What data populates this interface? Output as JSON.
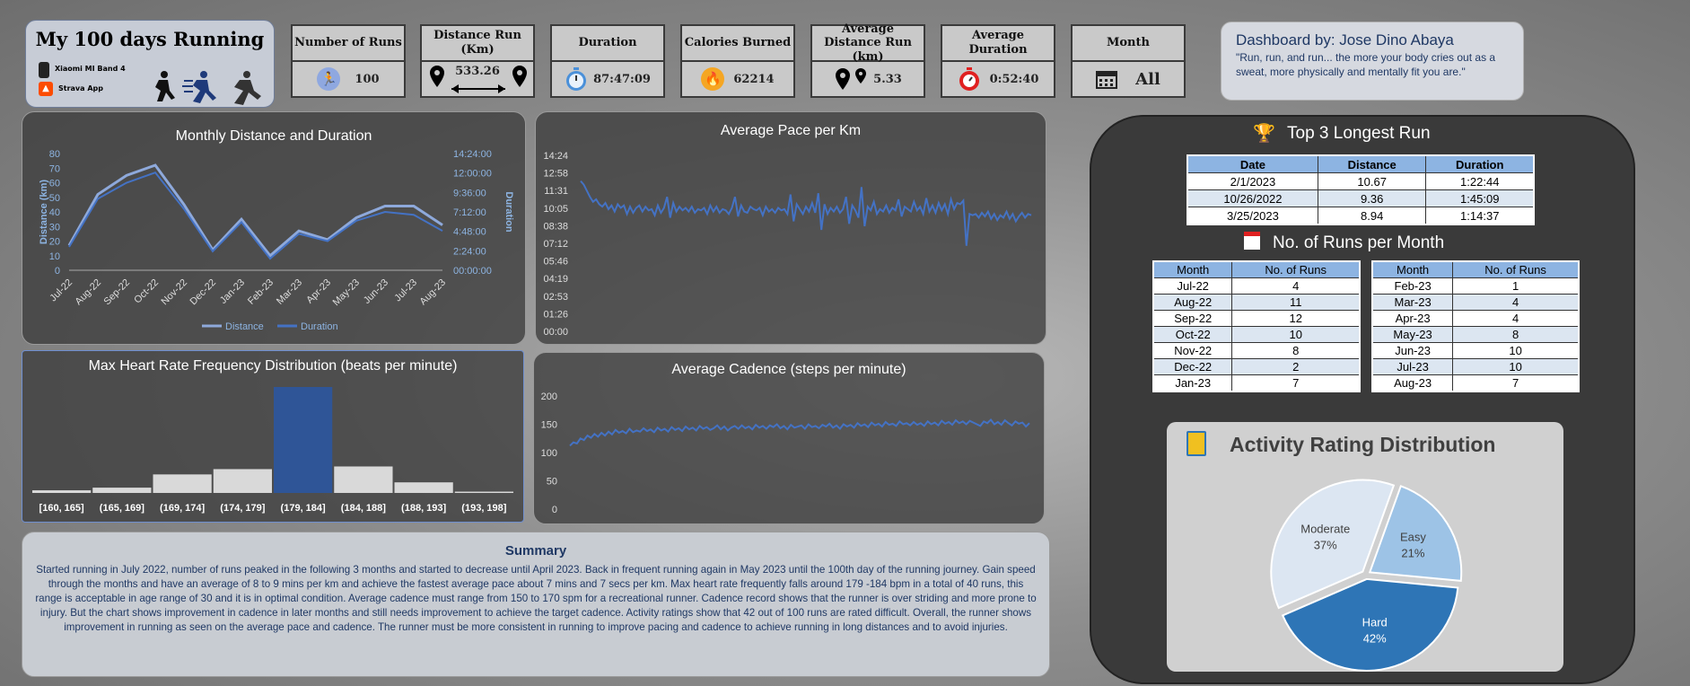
{
  "header": {
    "title": "My 100 days Running",
    "device": "Xiaomi MI Band 4",
    "app": "Strava App"
  },
  "kpis": [
    {
      "label": "Number of Runs",
      "value": "100",
      "icon": "runner-icon",
      "color": "#8fa8e0"
    },
    {
      "label": "Distance Run (Km)",
      "value": "533.26",
      "icon": "distance-icon"
    },
    {
      "label": "Duration",
      "value": "87:47:09",
      "icon": "stopwatch-icon",
      "color": "#4a90d9"
    },
    {
      "label": "Calories Burned",
      "value": "62214",
      "icon": "flame-icon",
      "color": "#f5a623"
    },
    {
      "label": "Average Distance Run (km)",
      "value": "5.33",
      "icon": "location-pin-icon"
    },
    {
      "label": "Average Duration",
      "value": "0:52:40",
      "icon": "timer-icon",
      "color": "#e02020"
    },
    {
      "label": "Month",
      "value": "All",
      "icon": "calendar-icon"
    }
  ],
  "credit": {
    "title": "Dashboard by: Jose Dino Abaya",
    "quote": "\"Run, run, and run... the more your body cries out as a sweat, more physically and mentally fit you are.\""
  },
  "chart_data": [
    {
      "type": "line",
      "title": "Monthly Distance and Duration",
      "xlabel": "",
      "ylabel": "Distance (km)",
      "y2label": "Duration",
      "categories": [
        "Jul-22",
        "Aug-22",
        "Sep-22",
        "Oct-22",
        "Nov-22",
        "Dec-22",
        "Jan-23",
        "Feb-23",
        "Mar-23",
        "Apr-23",
        "May-23",
        "Jun-23",
        "Jul-23",
        "Aug-23"
      ],
      "ylim": [
        0,
        80
      ],
      "yticks": [
        "0",
        "10",
        "20",
        "30",
        "40",
        "50",
        "60",
        "70",
        "80"
      ],
      "y2ticks": [
        "00:00:00",
        "2:24:00",
        "4:48:00",
        "7:12:00",
        "9:36:00",
        "12:00:00",
        "14:24:00"
      ],
      "series": [
        {
          "name": "Distance",
          "values": [
            17,
            52,
            65,
            72,
            45,
            14,
            35,
            10,
            27,
            21,
            36,
            44,
            44,
            31
          ],
          "color": "#8ea9db"
        },
        {
          "name": "Duration",
          "values": [
            16,
            49,
            60,
            67,
            42,
            13,
            33,
            8,
            25,
            20,
            34,
            40,
            38,
            27
          ],
          "color": "#4472c4"
        }
      ],
      "legend": "bottom",
      "grid": false
    },
    {
      "type": "line",
      "title": "Average Pace per Km",
      "yticks": [
        "00:00",
        "01:26",
        "02:53",
        "04:19",
        "05:46",
        "07:12",
        "08:38",
        "10:05",
        "11:31",
        "12:58",
        "14:24"
      ],
      "ylim": [
        0,
        14.4
      ],
      "series": [
        {
          "name": "",
          "color": "#4472c4",
          "values": [
            12.3,
            12.0,
            11.5,
            11.0,
            10.6,
            10.8,
            10.4,
            10.2,
            10.5,
            10.0,
            10.3,
            9.8,
            10.4,
            10.1,
            10.3,
            9.6,
            10.2,
            9.7,
            10.1,
            10.3,
            9.8,
            10.2,
            9.9,
            10.0,
            9.5,
            10.3,
            9.7,
            10.1,
            11.0,
            9.3,
            10.5,
            9.8,
            10.2,
            9.9,
            10.1,
            9.8,
            10.2,
            9.7,
            10.0,
            9.9,
            10.1,
            9.6,
            10.3,
            9.8,
            10.2,
            9.7,
            10.0,
            9.9,
            9.6,
            10.1,
            11.0,
            9.4,
            10.3,
            9.8,
            9.7,
            10.2,
            10.0,
            9.9,
            10.1,
            9.5,
            10.2,
            9.8,
            10.0,
            9.7,
            10.1,
            9.9,
            10.0,
            9.6,
            11.2,
            9.0,
            10.4,
            10.0,
            9.6,
            10.2,
            9.8,
            10.5,
            9.7,
            11.3,
            8.3,
            10.4,
            9.6,
            10.1,
            9.8,
            10.2,
            9.7,
            10.0,
            11.0,
            8.8,
            10.3,
            9.9,
            9.3,
            11.8,
            8.6,
            10.2,
            9.9,
            10.6,
            9.6,
            10.0,
            9.8,
            10.3,
            9.7,
            10.1,
            9.9,
            10.8,
            9.4,
            10.2,
            10.0,
            9.8,
            10.6,
            9.9,
            10.2,
            9.6,
            10.9,
            9.8,
            10.3,
            9.7,
            10.5,
            9.9,
            10.4,
            9.6,
            10.8,
            10.0,
            10.5,
            10.4,
            10.7,
            7.0,
            9.6,
            9.5,
            9.6,
            9.3,
            9.7,
            9.4,
            9.8,
            9.2,
            9.6,
            9.1,
            9.5,
            9.3,
            9.8,
            9.2,
            9.6,
            9.0,
            9.4,
            9.7,
            9.3,
            9.6,
            9.5
          ]
        }
      ]
    },
    {
      "type": "bar",
      "title": "Max Heart Rate Frequency Distribution (beats per minute)",
      "categories": [
        "[160, 165]",
        "(165, 169]",
        "(169, 174]",
        "(174, 179]",
        "(179, 184]",
        "(184, 188]",
        "(188, 193]",
        "(193, 198]"
      ],
      "values": [
        1,
        2,
        7,
        9,
        40,
        10,
        4,
        0.5
      ],
      "highlight_index": 4,
      "colors": {
        "bar": "#d9d9d9",
        "highlight": "#2f5597"
      }
    },
    {
      "type": "line",
      "title": "Average Cadence (steps per minute)",
      "yticks": [
        "0",
        "50",
        "100",
        "150",
        "200"
      ],
      "ylim": [
        0,
        200
      ],
      "series": [
        {
          "name": "",
          "color": "#4472c4",
          "values": [
            112,
            118,
            116,
            125,
            122,
            130,
            126,
            133,
            128,
            135,
            130,
            137,
            132,
            140,
            135,
            138,
            134,
            142,
            136,
            139,
            137,
            143,
            138,
            141,
            136,
            144,
            139,
            142,
            137,
            145,
            140,
            143,
            138,
            146,
            141,
            144,
            139,
            147,
            142,
            145,
            140,
            143,
            148,
            141,
            146,
            139,
            144,
            147,
            142,
            148,
            143,
            146,
            141,
            149,
            144,
            147,
            142,
            148,
            145,
            150,
            143,
            147,
            141,
            149,
            144,
            146,
            148,
            142,
            150,
            145,
            147,
            143,
            149,
            146,
            151,
            144,
            148,
            142,
            150,
            146,
            149,
            144,
            152,
            147,
            150,
            145,
            153,
            148,
            151,
            146,
            154,
            149,
            151,
            147,
            155,
            150,
            152,
            148,
            154,
            149,
            152,
            147,
            155,
            150,
            153,
            148,
            156,
            151,
            154,
            149,
            157,
            152,
            155,
            150,
            156,
            153,
            150,
            147,
            155,
            152,
            158,
            150,
            154,
            149,
            157,
            152,
            148,
            155,
            151,
            153,
            146,
            152
          ]
        }
      ]
    },
    {
      "type": "pie",
      "title": "Activity Rating Distribution",
      "slices": [
        {
          "label": "Moderate",
          "value": 37,
          "pct": "37%",
          "color": "#dce6f2"
        },
        {
          "label": "Easy",
          "value": 21,
          "pct": "21%",
          "color": "#9dc3e6"
        },
        {
          "label": "Hard",
          "value": 42,
          "pct": "42%",
          "color": "#2e75b6"
        }
      ]
    }
  ],
  "top_runs": {
    "title": "Top 3 Longest Run",
    "headers": [
      "Date",
      "Distance",
      "Duration"
    ],
    "rows": [
      [
        "2/1/2023",
        "10.67",
        "1:22:44"
      ],
      [
        "10/26/2022",
        "9.36",
        "1:45:09"
      ],
      [
        "3/25/2023",
        "8.94",
        "1:14:37"
      ]
    ]
  },
  "runs_per_month": {
    "title": "No. of Runs per Month",
    "headers": [
      "Month",
      "No. of Runs"
    ],
    "left": [
      [
        "Jul-22",
        "4"
      ],
      [
        "Aug-22",
        "11"
      ],
      [
        "Sep-22",
        "12"
      ],
      [
        "Oct-22",
        "10"
      ],
      [
        "Nov-22",
        "8"
      ],
      [
        "Dec-22",
        "2"
      ],
      [
        "Jan-23",
        "7"
      ]
    ],
    "right": [
      [
        "Feb-23",
        "1"
      ],
      [
        "Mar-23",
        "4"
      ],
      [
        "Apr-23",
        "4"
      ],
      [
        "May-23",
        "8"
      ],
      [
        "Jun-23",
        "10"
      ],
      [
        "Jul-23",
        "10"
      ],
      [
        "Aug-23",
        "7"
      ]
    ]
  },
  "summary": {
    "title": "Summary",
    "text": "Started running in July 2022, number of runs peaked in the following 3 months and started to decrease until April 2023. Back in frequent running again in May 2023 until the 100th day of the running journey. Gain speed through the months and have an average of 8 to 9 mins per km and achieve the fastest average pace about 7 mins and 7 secs per km. Max heart rate frequently falls around 179 -184 bpm in a total of 40 runs, this range is acceptable in age range of 30 and it is in optimal condition. Average cadence must range from 150 to 170 spm for a recreational runner. Cadence record shows that the runner is over striding and more prone to injury. But the chart shows improvement in cadence in later months and still needs improvement to achieve the target cadence. Activity ratings show that 42 out of 100 runs are rated difficult. Overall, the runner shows improvement in running as seen on the average pace and cadence. The runner must be more consistent in running to improve pacing and cadence to achieve running in long distances and to avoid injuries."
  }
}
